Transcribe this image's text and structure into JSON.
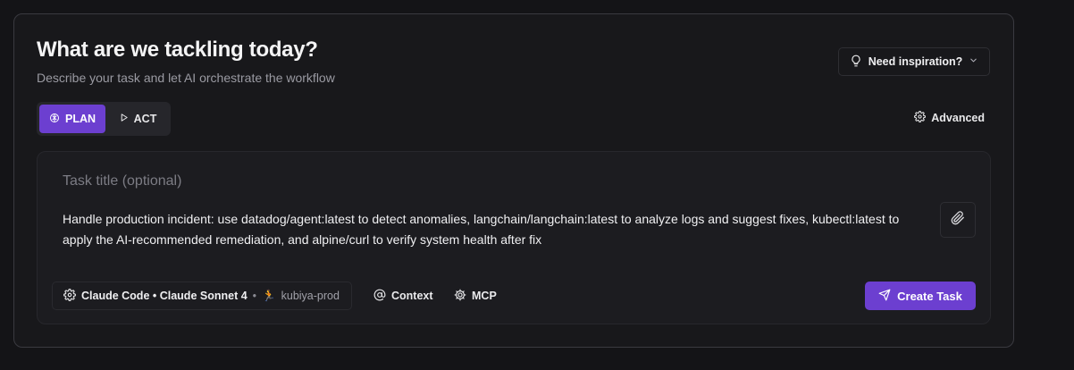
{
  "header": {
    "title": "What are we tackling today?",
    "subtitle": "Describe your task and let AI orchestrate the workflow",
    "inspiration_label": "Need inspiration?"
  },
  "modes": {
    "plan_label": "PLAN",
    "act_label": "ACT",
    "selected": "PLAN"
  },
  "advanced_label": "Advanced",
  "composer": {
    "title_placeholder": "Task title (optional)",
    "title_value": "",
    "description": "Handle production incident: use datadog/agent:latest to detect anomalies, langchain/langchain:latest to analyze logs and suggest fixes, kubectl:latest to apply the AI-recommended remediation, and alpine/curl to verify system health after fix",
    "model_label": "Claude Code • Claude Sonnet 4",
    "separator": "•",
    "env_emoji": "🏃",
    "environment": "kubiya-prod",
    "context_label": "Context",
    "mcp_label": "MCP",
    "create_label": "Create Task"
  },
  "colors": {
    "accent": "#6c3fd0",
    "background": "#141417",
    "card": "#18181b"
  }
}
